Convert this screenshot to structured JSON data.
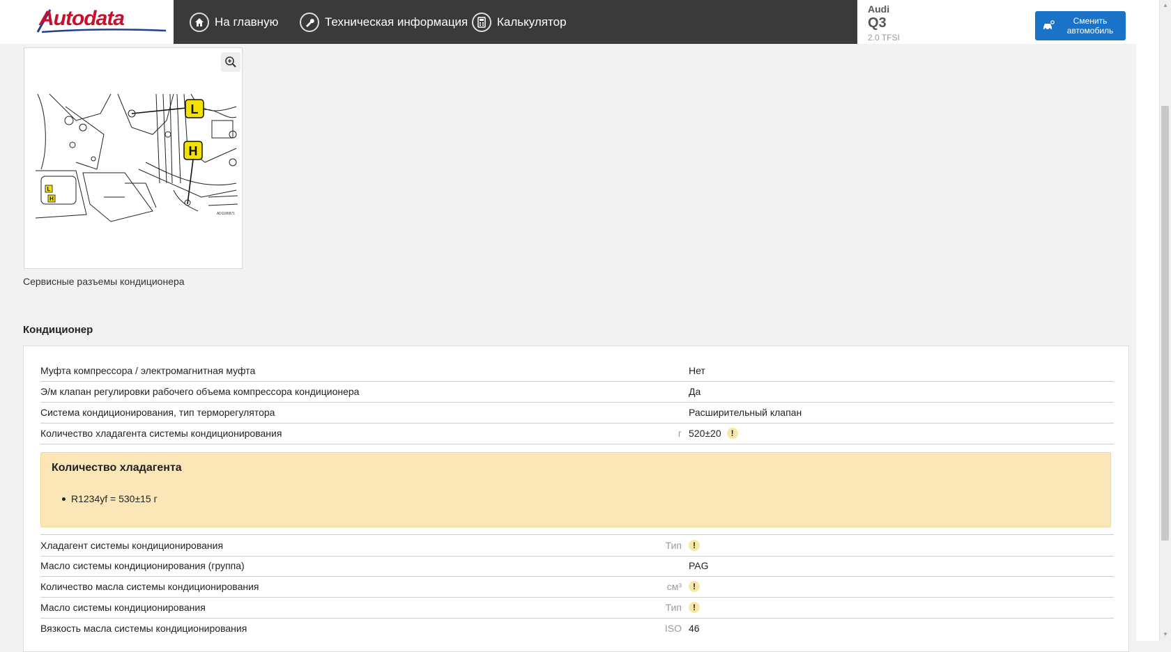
{
  "brand": {
    "logo_text": "Autodata"
  },
  "nav": {
    "home": "На главную",
    "tech_info": "Техническая информация",
    "calculator": "Калькулятор"
  },
  "vehicle": {
    "make": "Audi",
    "model": "Q3",
    "engine": "2.0 TFSI",
    "change_button": "Сменить автомобиль"
  },
  "figure": {
    "caption": "Сервисные разъемы кондиционера",
    "callouts": [
      "L",
      "H"
    ],
    "ref_code": "AD1186871"
  },
  "section": {
    "title": "Кондиционер",
    "rows_top": [
      {
        "label": "Муфта компрессора / электромагнитная муфта",
        "unit": "",
        "value": "Нет",
        "warning": false
      },
      {
        "label": "Э/м клапан регулировки рабочего объема компрессора кондиционера",
        "unit": "",
        "value": "Да",
        "warning": false
      },
      {
        "label": "Система кондиционирования, тип терморегулятора",
        "unit": "",
        "value": "Расширительный клапан",
        "warning": false
      },
      {
        "label": "Количество хладагента системы кондиционирования",
        "unit": "г",
        "value": "520±20",
        "warning": true
      }
    ],
    "note": {
      "title": "Количество хладагента",
      "items": [
        "R1234yf = 530±15 г"
      ]
    },
    "rows_bottom": [
      {
        "label": "Хладагент системы кондиционирования",
        "unit": "Тип",
        "value": "",
        "warning": true
      },
      {
        "label": "Масло системы кондиционирования (группа)",
        "unit": "",
        "value": "PAG",
        "warning": false
      },
      {
        "label": "Количество масла системы кондиционирования",
        "unit": "см³",
        "value": "",
        "warning": true
      },
      {
        "label": "Масло системы кондиционирования",
        "unit": "Тип",
        "value": "",
        "warning": true
      },
      {
        "label": "Вязкость масла системы кондиционирования",
        "unit": "ISO",
        "value": "46",
        "warning": false
      }
    ]
  }
}
